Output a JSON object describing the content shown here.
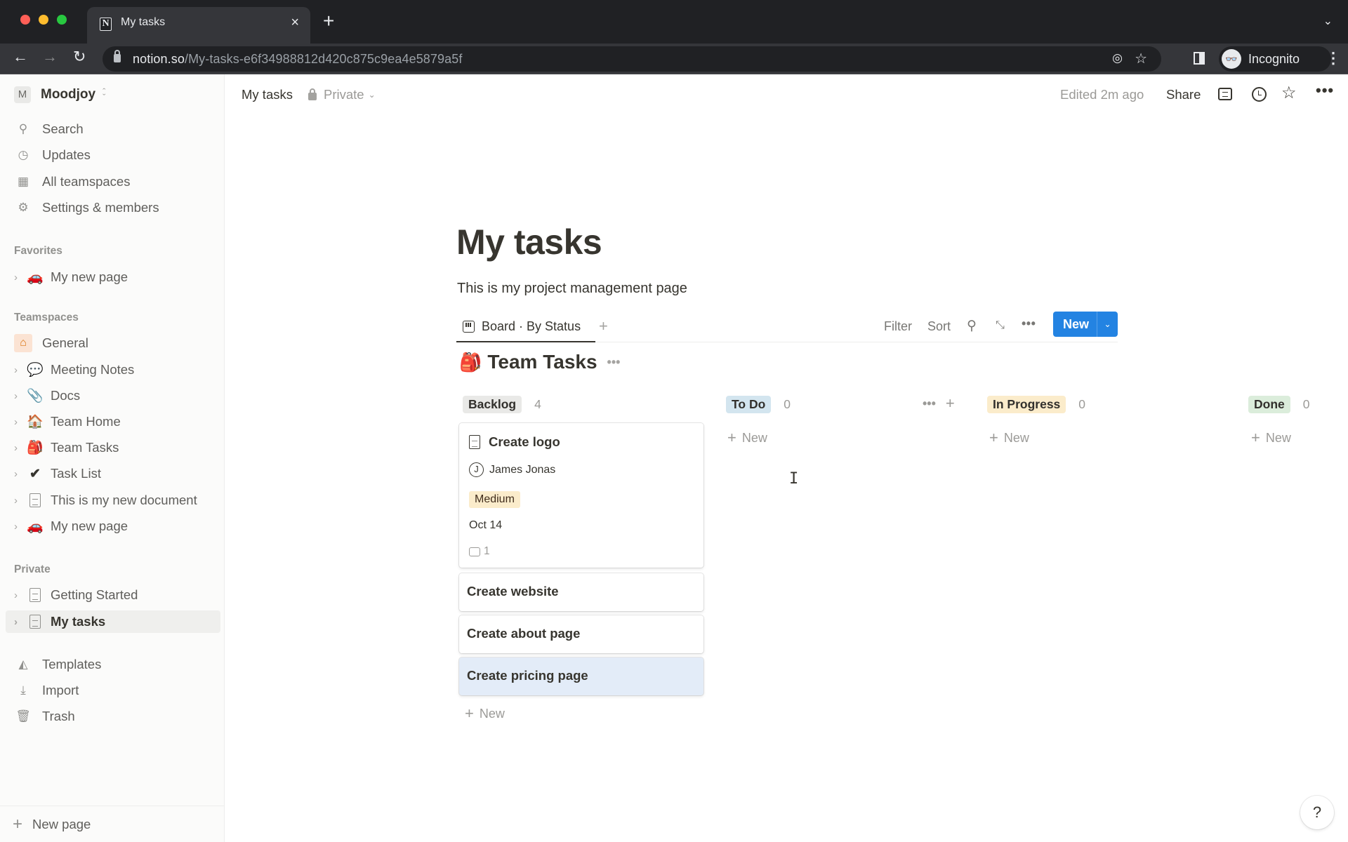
{
  "browser": {
    "tab_title": "My tasks",
    "tab_favicon": "N",
    "url_host": "notion.so",
    "url_path": "/My-tasks-e6f34988812d420c875c9ea4e5879a5f",
    "profile_label": "Incognito"
  },
  "sidebar": {
    "workspace": {
      "initial": "M",
      "name": "Moodjoy"
    },
    "nav": [
      {
        "icon": "search-icon",
        "label": "Search"
      },
      {
        "icon": "clock-icon",
        "label": "Updates"
      },
      {
        "icon": "building-icon",
        "label": "All teamspaces"
      },
      {
        "icon": "gear-icon",
        "label": "Settings & members"
      }
    ],
    "favorites_heading": "Favorites",
    "favorites": [
      {
        "emoji": "🚗",
        "label": "My new page"
      }
    ],
    "teamspaces_heading": "Teamspaces",
    "teamspace_general": {
      "icon": "home-icon",
      "label": "General"
    },
    "teamspace_pages": [
      {
        "emoji": "💬",
        "label": "Meeting Notes"
      },
      {
        "emoji": "📎",
        "label": "Docs"
      },
      {
        "emoji": "🏠",
        "label": "Team Home"
      },
      {
        "emoji": "🎒",
        "label": "Team Tasks"
      },
      {
        "emoji": "✔",
        "label": "Task List"
      },
      {
        "emoji": "doc",
        "label": "This is my new document"
      },
      {
        "emoji": "🚗",
        "label": "My new page"
      }
    ],
    "private_heading": "Private",
    "private_pages": [
      {
        "label": "Getting Started",
        "active": false
      },
      {
        "label": "My tasks",
        "active": true
      }
    ],
    "utilities": [
      {
        "icon": "templates-icon",
        "label": "Templates"
      },
      {
        "icon": "import-icon",
        "label": "Import"
      },
      {
        "icon": "trash-icon",
        "label": "Trash"
      }
    ],
    "new_page_label": "New page"
  },
  "topbar": {
    "breadcrumb": "My tasks",
    "privacy": "Private",
    "edited": "Edited 2m ago",
    "share": "Share"
  },
  "page": {
    "title": "My tasks",
    "description": "This is my project management page",
    "view_tab": "Board · By Status",
    "view_actions": {
      "filter": "Filter",
      "sort": "Sort"
    },
    "new_button": "New",
    "database": {
      "emoji": "🎒",
      "name": "Team Tasks"
    }
  },
  "board": {
    "columns": [
      {
        "status": "Backlog",
        "count": "4",
        "color": "#e9e9e7"
      },
      {
        "status": "To Do",
        "count": "0",
        "color": "#d3e5ef"
      },
      {
        "status": "In Progress",
        "count": "0",
        "color": "#fbeccb"
      },
      {
        "status": "Done",
        "count": "0",
        "color": "#dbeddb"
      }
    ],
    "cards": [
      {
        "title": "Create logo",
        "assignee": "James Jonas",
        "assignee_initial": "J",
        "priority": "Medium",
        "due": "Oct 14",
        "comments": "1"
      },
      {
        "title": "Create website"
      },
      {
        "title": "Create about page"
      },
      {
        "title": "Create pricing page"
      }
    ],
    "new_label": "New"
  },
  "help_label": "?"
}
